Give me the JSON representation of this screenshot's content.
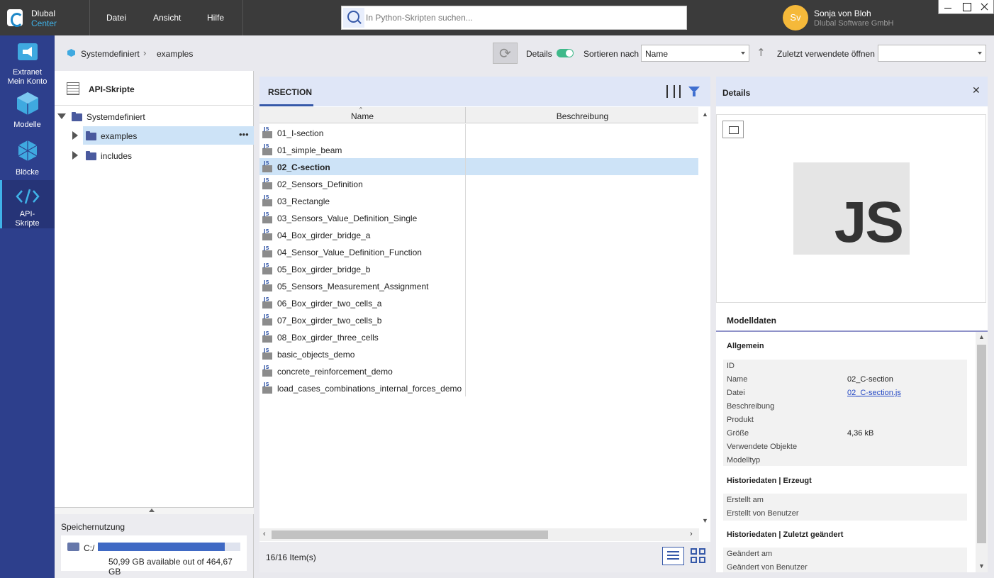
{
  "app": {
    "brand_line1": "Dlubal",
    "brand_line2": "Center"
  },
  "menu": [
    "Datei",
    "Ansicht",
    "Hilfe"
  ],
  "search": {
    "placeholder": "In Python-Skripten suchen..."
  },
  "user": {
    "initials": "Sv",
    "name": "Sonja von Bloh",
    "company": "Dlubal Software GmbH"
  },
  "nav": [
    {
      "label": "Extranet\nMein Konto",
      "icon": "megaphone-icon"
    },
    {
      "label": "Modelle",
      "icon": "cube-icon"
    },
    {
      "label": "Blöcke",
      "icon": "blocks-icon"
    },
    {
      "label": "API-\nSkripte",
      "icon": "code-icon",
      "active": true
    }
  ],
  "breadcrumb": {
    "root": "Systemdefiniert",
    "current": "examples"
  },
  "toolbar": {
    "details_label": "Details",
    "details_on": true,
    "sort_label": "Sortieren nach",
    "sort_value": "Name",
    "recent_label": "Zuletzt verwendete öffnen",
    "recent_value": ""
  },
  "tree": {
    "title": "API-Skripte",
    "root": "Systemdefiniert",
    "children": [
      {
        "label": "examples",
        "selected": true
      },
      {
        "label": "includes",
        "selected": false
      }
    ]
  },
  "storage": {
    "title": "Speichernutzung",
    "drive": "C:/",
    "used_fraction": 0.89,
    "text": "50,99 GB available out of 464,67 GB"
  },
  "list": {
    "tab": "RSECTION",
    "col_name": "Name",
    "col_desc": "Beschreibung",
    "items": [
      "01_I-section",
      "01_simple_beam",
      "02_C-section",
      "02_Sensors_Definition",
      "03_Rectangle",
      "03_Sensors_Value_Definition_Single",
      "04_Box_girder_bridge_a",
      "04_Sensor_Value_Definition_Function",
      "05_Box_girder_bridge_b",
      "05_Sensors_Measurement_Assignment",
      "06_Box_girder_two_cells_a",
      "07_Box_girder_two_cells_b",
      "08_Box_girder_three_cells",
      "basic_objects_demo",
      "concrete_reinforcement_demo",
      "load_cases_combinations_internal_forces_demo"
    ],
    "selected_index": 2,
    "count": "16/16 Item(s)"
  },
  "details": {
    "title": "Details",
    "logo_text": "JS",
    "model_tab": "Modelldaten",
    "general": {
      "title": "Allgemein",
      "rows": [
        {
          "key": "ID",
          "value": ""
        },
        {
          "key": "Name",
          "value": "02_C-section"
        },
        {
          "key": "Datei",
          "value": "02_C-section.js",
          "link": true
        },
        {
          "key": "Beschreibung",
          "value": ""
        },
        {
          "key": "Produkt",
          "value": ""
        },
        {
          "key": "Größe",
          "value": "4,36 kB"
        },
        {
          "key": "Verwendete Objekte",
          "value": ""
        },
        {
          "key": "Modelltyp",
          "value": ""
        }
      ]
    },
    "created": {
      "title": "Historiedaten | Erzeugt",
      "rows": [
        {
          "key": "Erstellt am",
          "value": ""
        },
        {
          "key": "Erstellt von Benutzer",
          "value": ""
        }
      ]
    },
    "modified": {
      "title": "Historiedaten | Zuletzt geändert",
      "rows": [
        {
          "key": "Geändert am",
          "value": ""
        },
        {
          "key": "Geändert von Benutzer",
          "value": ""
        }
      ]
    }
  },
  "colors": {
    "nav_bg": "#2d3f8c",
    "accent": "#3558a8",
    "selection": "#cde3f7",
    "toggle_on": "#3fb98a"
  }
}
